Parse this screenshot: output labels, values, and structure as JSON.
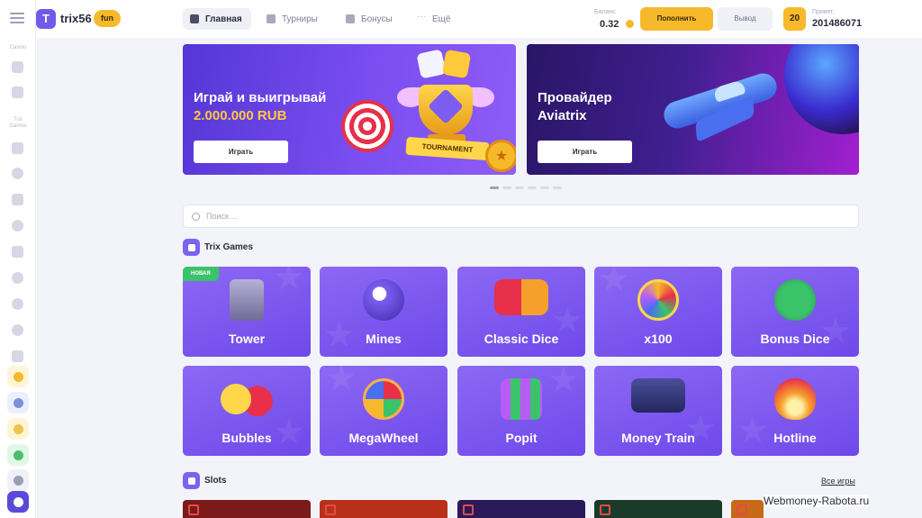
{
  "sidebar": {
    "section_casino": "Casino",
    "section_trix_games": "Trix Games",
    "icons": [
      "menu-icon",
      "casino-games-icon",
      "live-casino-icon",
      "tower-icon",
      "mines-icon",
      "dice-icon",
      "crash-icon",
      "x100-icon",
      "bonus-dice-icon",
      "bubbles-icon",
      "megawheel-icon",
      "popit-icon"
    ],
    "action_icons": [
      "tournament-icon",
      "referral-icon",
      "gift-icon",
      "chat-icon",
      "moon-icon",
      "sun-icon"
    ]
  },
  "header": {
    "logo_letter": "T",
    "logo_text": "trix56",
    "badge": "fun",
    "nav": [
      {
        "label": "Главная",
        "icon": "home-icon"
      },
      {
        "label": "Турниры",
        "icon": "trophy-icon"
      },
      {
        "label": "Бонусы",
        "icon": "gift-icon"
      },
      {
        "label": "Ещё",
        "icon": "more-icon"
      }
    ],
    "balance_label": "Баланс",
    "balance_value": "0.32",
    "deposit_label": "Пополнить",
    "withdraw_label": "Вывод",
    "level": "20",
    "hello_label": "Привет,",
    "user_id": "201486071"
  },
  "banners": [
    {
      "title": "Играй и выигрывай",
      "subtitle": "2.000.000 RUB",
      "button": "Играть",
      "ribbon": "TOURNAMENT"
    },
    {
      "title": "Провайдер",
      "subtitle": "Aviatrix",
      "button": "Играть"
    }
  ],
  "carousel": {
    "count": 6,
    "active": 0
  },
  "search": {
    "placeholder": "Поиск ..."
  },
  "trix_games": {
    "title": "Trix Games",
    "new_badge": "НОВАЯ",
    "games": [
      "Tower",
      "Mines",
      "Classic Dice",
      "x100",
      "Bonus Dice",
      "Bubbles",
      "MegaWheel",
      "Popit",
      "Money Train",
      "Hotline"
    ]
  },
  "slots": {
    "title": "Slots",
    "all_link": "Все игры"
  },
  "watermark": "Webmoney-Rabota.ru",
  "colors": {
    "accent": "#6f5be8",
    "yellow": "#f6b92c",
    "card": "#7b57ee",
    "new": "#3bc36a"
  }
}
